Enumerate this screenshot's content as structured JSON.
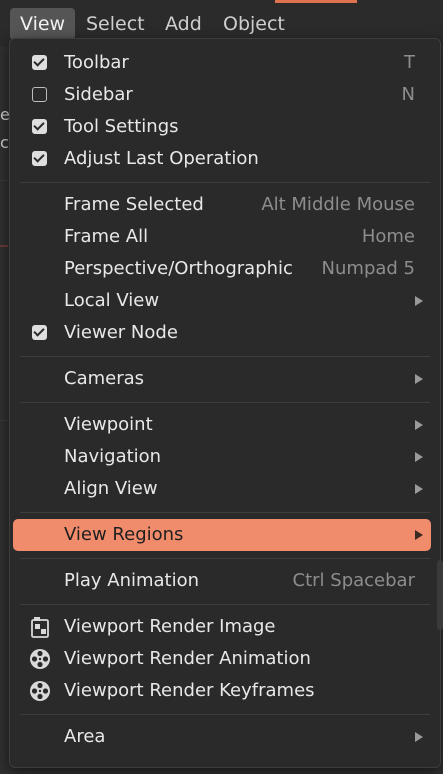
{
  "menubar": {
    "items": [
      {
        "label": "View",
        "active": true
      },
      {
        "label": "Select",
        "active": false
      },
      {
        "label": "Add",
        "active": false
      },
      {
        "label": "Object",
        "active": false
      }
    ]
  },
  "background": {
    "edge_letters": [
      "e",
      "c"
    ]
  },
  "colors": {
    "highlight": "#f08c6c",
    "accent_top": "#e0734f",
    "menu_bg": "#2a2a2a"
  },
  "menu": {
    "items": [
      {
        "label": "Toolbar",
        "shortcut": "T",
        "check": "checked"
      },
      {
        "label": "Sidebar",
        "shortcut": "N",
        "check": "unchecked"
      },
      {
        "label": "Tool Settings",
        "shortcut": "",
        "check": "checked"
      },
      {
        "label": "Adjust Last Operation",
        "shortcut": "",
        "check": "checked"
      },
      {
        "label": "Frame Selected",
        "shortcut": "Alt Middle Mouse"
      },
      {
        "label": "Frame All",
        "shortcut": "Home"
      },
      {
        "label": "Perspective/Orthographic",
        "shortcut": "Numpad 5"
      },
      {
        "label": "Local View",
        "shortcut": "",
        "submenu": true
      },
      {
        "label": "Viewer Node",
        "shortcut": "",
        "check": "checked"
      },
      {
        "label": "Cameras",
        "shortcut": "",
        "submenu": true
      },
      {
        "label": "Viewpoint",
        "shortcut": "",
        "submenu": true
      },
      {
        "label": "Navigation",
        "shortcut": "",
        "submenu": true
      },
      {
        "label": "Align View",
        "shortcut": "",
        "submenu": true
      },
      {
        "label": "View Regions",
        "shortcut": "",
        "submenu": true,
        "highlighted": true
      },
      {
        "label": "Play Animation",
        "shortcut": "Ctrl Spacebar"
      },
      {
        "label": "Viewport Render Image",
        "shortcut": "",
        "icon": "render-still-icon"
      },
      {
        "label": "Viewport Render Animation",
        "shortcut": "",
        "icon": "render-animation-icon"
      },
      {
        "label": "Viewport Render Keyframes",
        "shortcut": "",
        "icon": "render-animation-icon"
      },
      {
        "label": "Area",
        "shortcut": "",
        "submenu": true
      }
    ]
  }
}
